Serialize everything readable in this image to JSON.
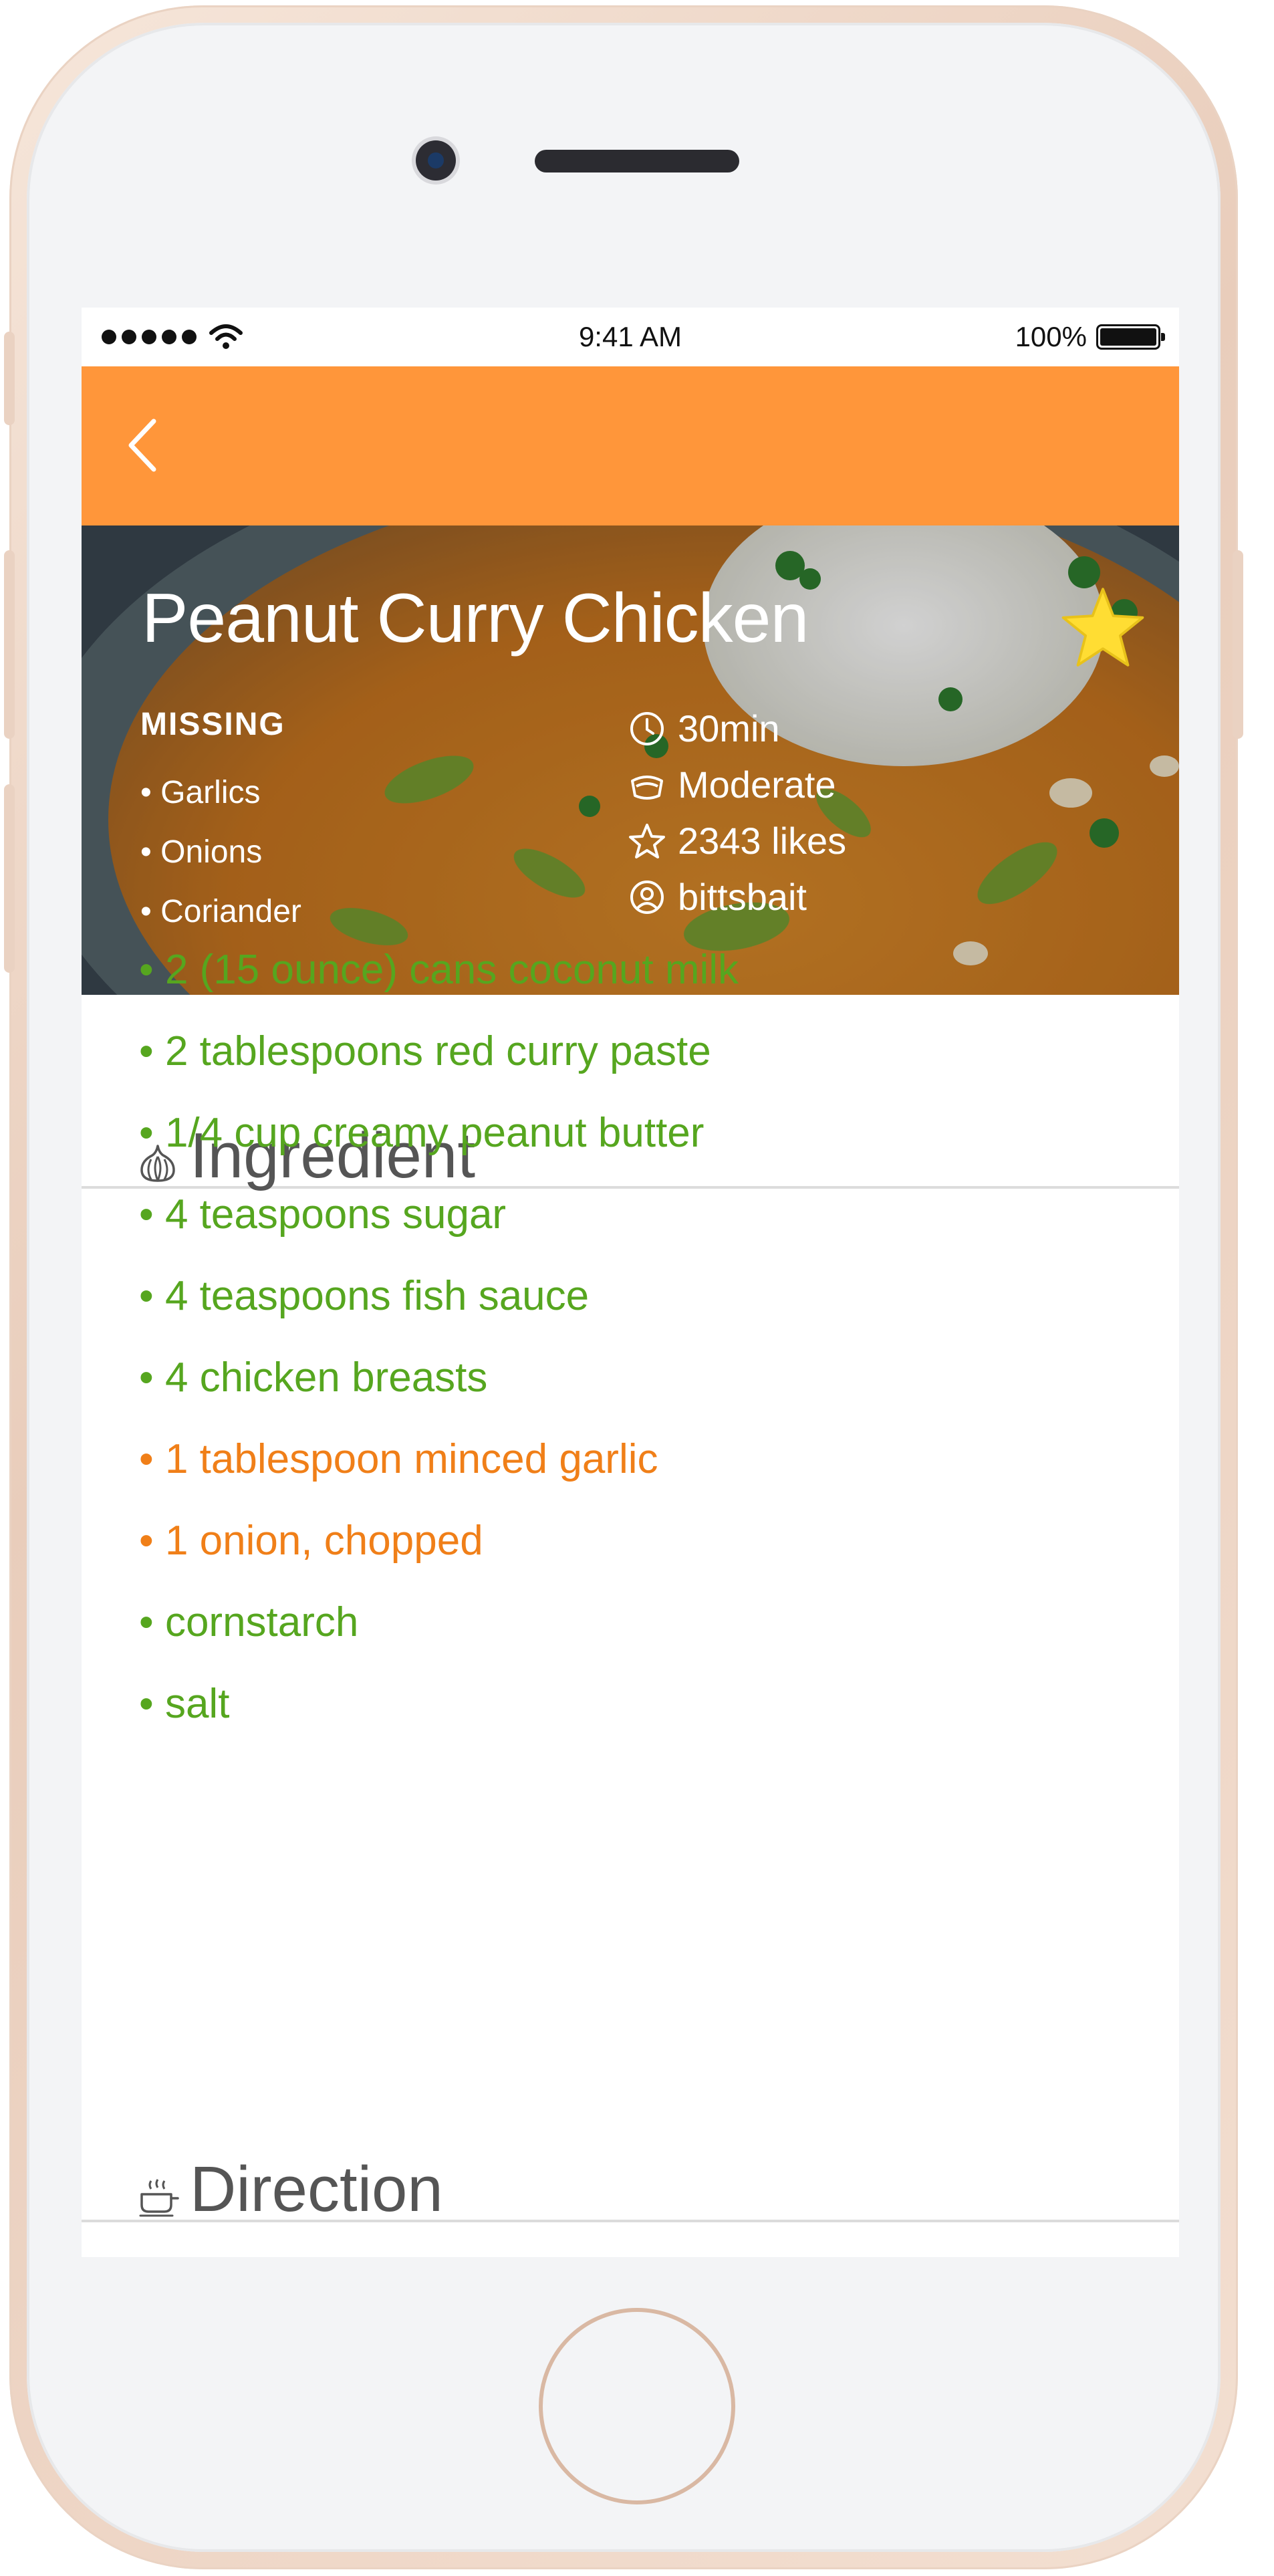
{
  "status_bar": {
    "time": "9:41 AM",
    "battery": "100%"
  },
  "recipe": {
    "title": "Peanut Curry Chicken",
    "missing_heading": "MISSING",
    "missing": [
      "Garlics",
      "Onions",
      "Coriander"
    ],
    "meta": {
      "time": "30min",
      "difficulty": "Moderate",
      "likes": "2343 likes",
      "author": "bittsbait"
    }
  },
  "sections": {
    "ingredient_heading": "Ingredient",
    "direction_heading": "Direction"
  },
  "ingredients": [
    {
      "text": "2 (15 ounce) cans coconut milk",
      "status": "available"
    },
    {
      "text": "2 tablespoons red curry paste",
      "status": "available"
    },
    {
      "text": "1/4 cup creamy peanut butter",
      "status": "available"
    },
    {
      "text": "4 teaspoons sugar",
      "status": "available"
    },
    {
      "text": "4 teaspoons fish sauce",
      "status": "available"
    },
    {
      "text": "4 chicken breasts",
      "status": "available"
    },
    {
      "text": "1 tablespoon minced garlic",
      "status": "missing"
    },
    {
      "text": "1 onion, chopped",
      "status": "missing"
    },
    {
      "text": "cornstarch",
      "status": "available"
    },
    {
      "text": "salt",
      "status": "available"
    }
  ],
  "colors": {
    "appbar": "#ff963a",
    "available": "#56a61f",
    "missing": "#f07f18",
    "favorite_star": "#ffdd33"
  },
  "icons": [
    "back-arrow-icon",
    "favorite-star-icon",
    "clock-icon",
    "difficulty-icon",
    "star-outline-icon",
    "user-icon",
    "garlic-icon",
    "cooking-pot-icon"
  ]
}
